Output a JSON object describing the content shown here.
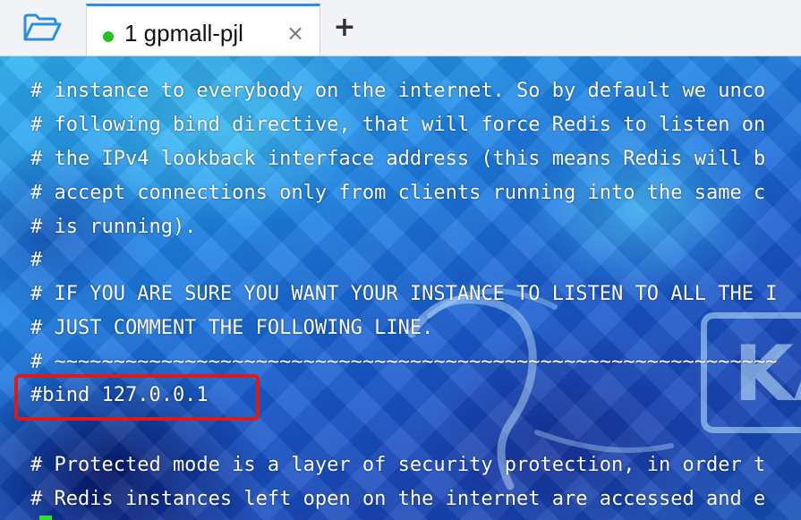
{
  "tabbar": {
    "folder_icon": "folder-open-icon",
    "tab": {
      "status_color": "#1ec41e",
      "title": "1 gpmall-pjl",
      "close_label": "×"
    },
    "new_tab_label": "+"
  },
  "terminal": {
    "lines": [
      "# instance to everybody on the internet. So by default we unco",
      "# following bind directive, that will force Redis to listen on",
      "# the IPv4 lookback interface address (this means Redis will b",
      "# accept connections only from clients running into the same c",
      "# is running).",
      "#",
      "# IF YOU ARE SURE YOU WANT YOUR INSTANCE TO LISTEN TO ALL THE I",
      "# JUST COMMENT THE FOLLOWING LINE.",
      "# ~~~~~~~~~~~~~~~~~~~~~~~~~~~~~~~~~~~~~~~~~~~~~~~~~~~~~~~~~~~~~",
      "#bind 127.0.0.1",
      "",
      "# Protected mode is a layer of security protection, in order t",
      "# Redis instances left open on the internet are accessed and e"
    ],
    "wallpaper_text": "KA",
    "highlight_color": "#e01818",
    "cursor_color": "#2ee02e"
  }
}
